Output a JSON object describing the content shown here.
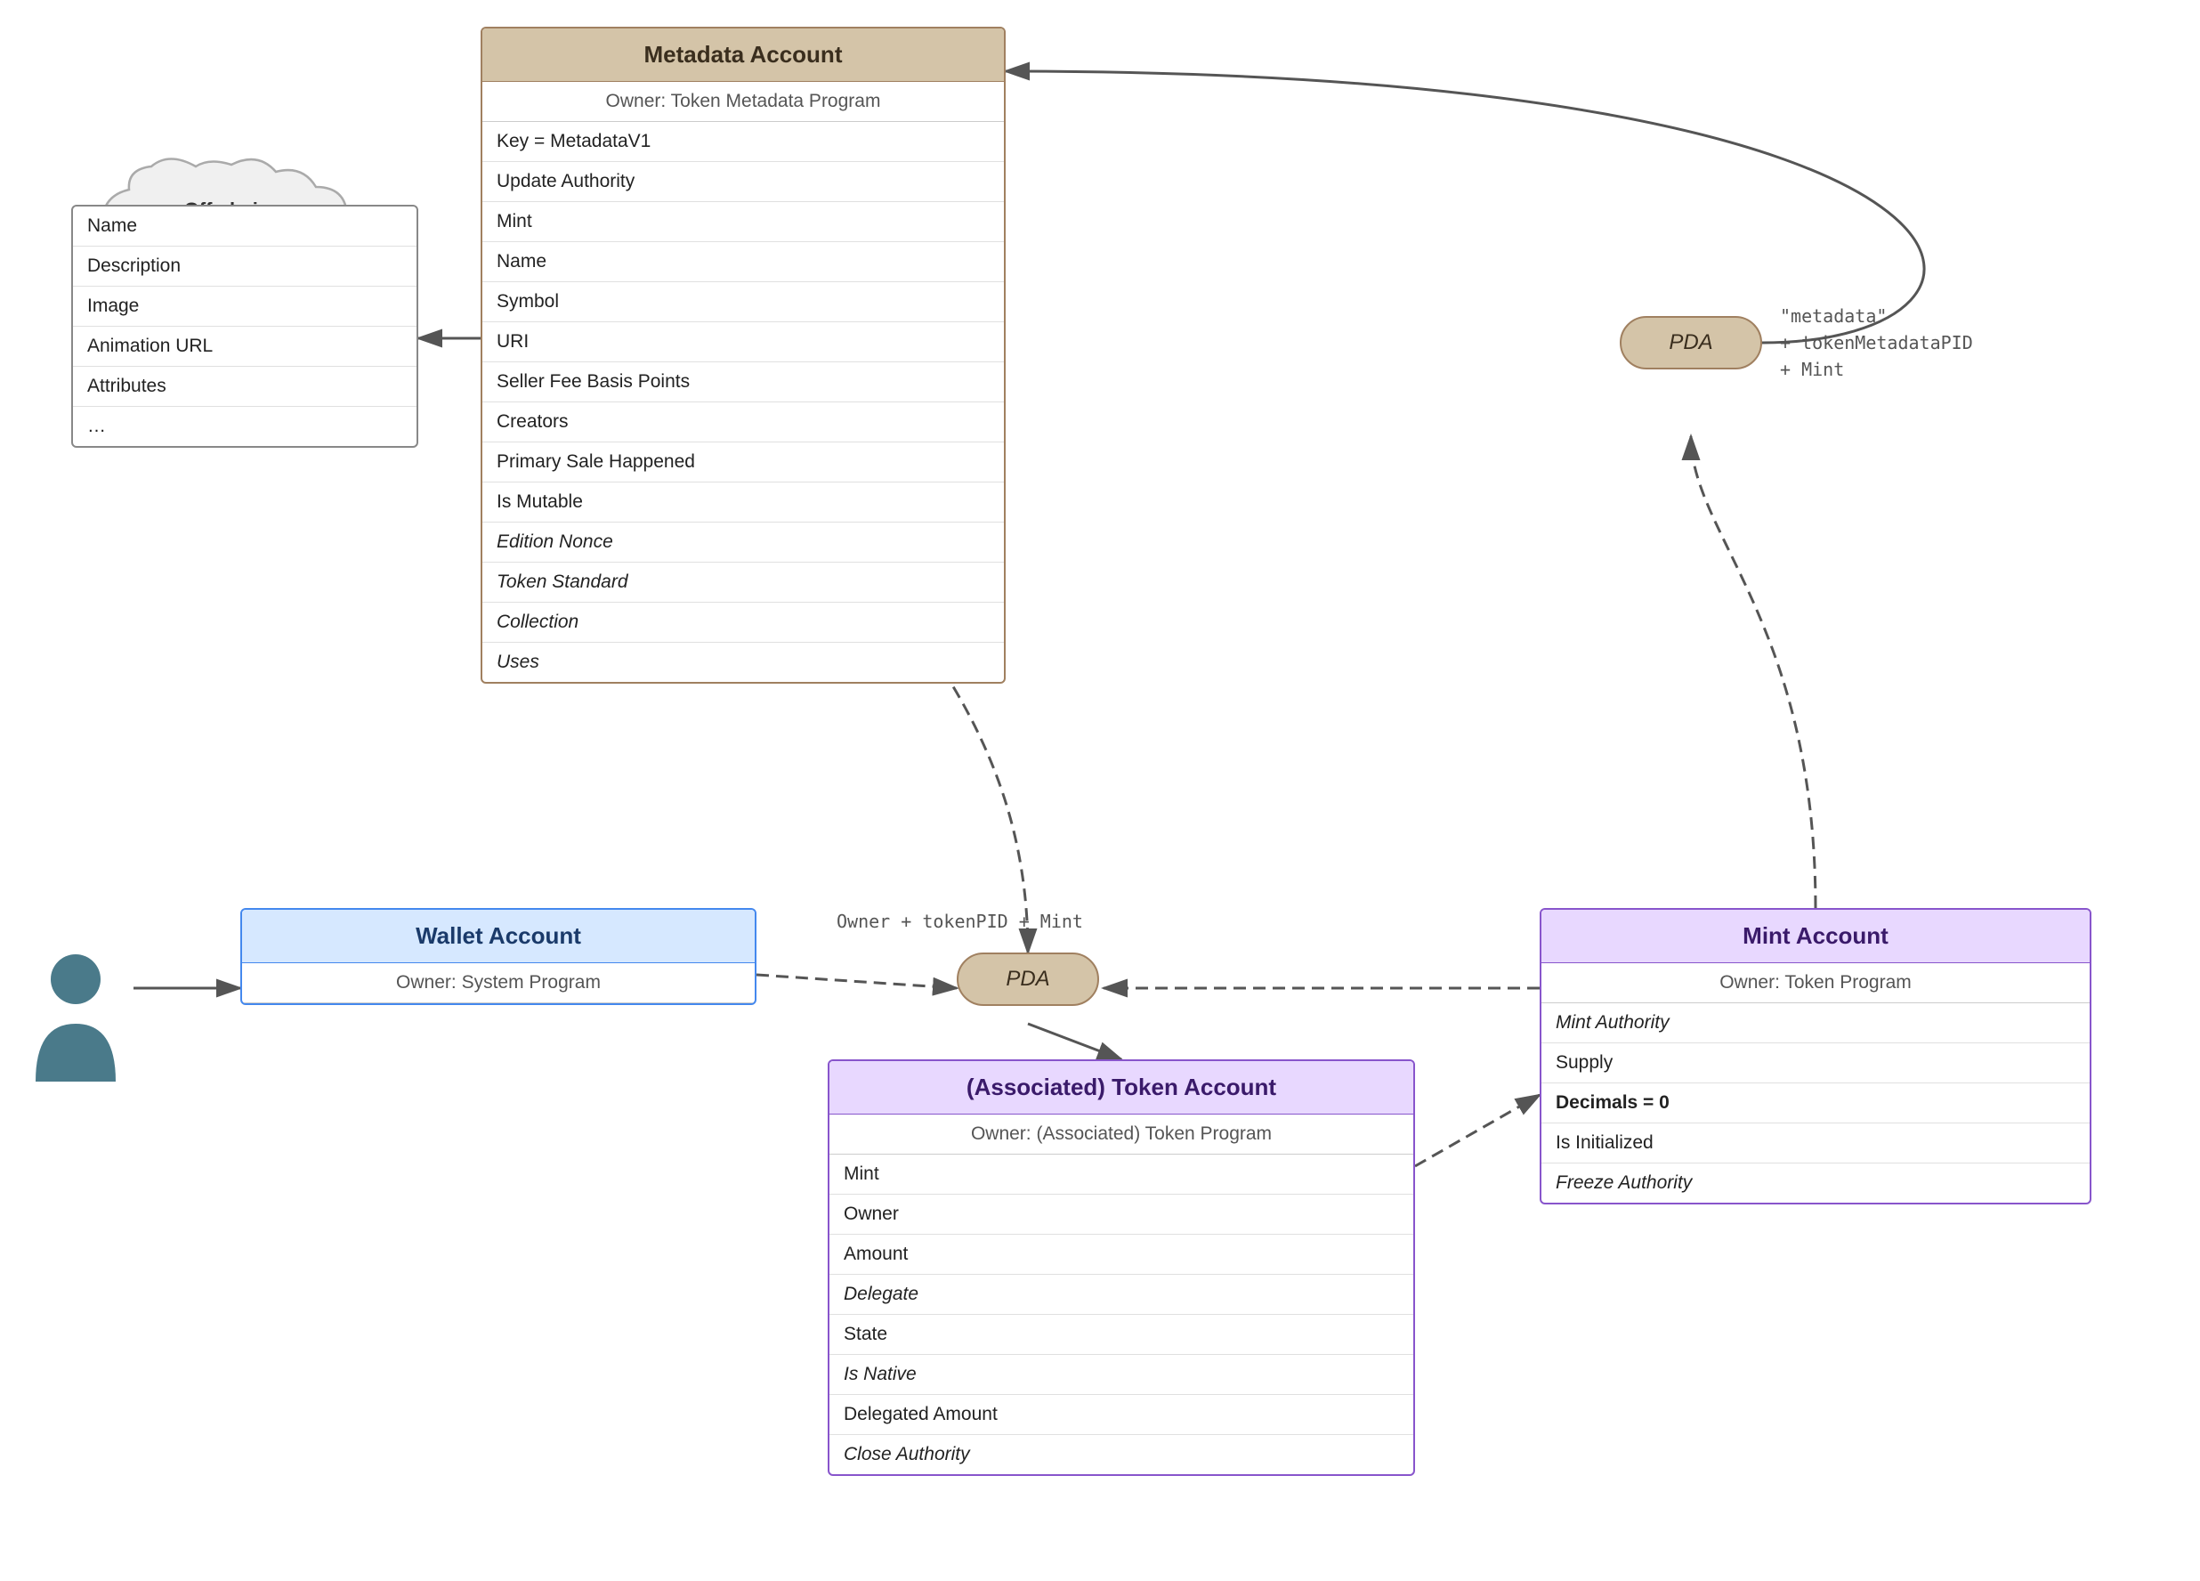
{
  "metadata_account": {
    "title": "Metadata Account",
    "owner": "Owner: Token Metadata Program",
    "rows": [
      {
        "text": "Key = MetadataV1",
        "style": "normal"
      },
      {
        "text": "Update Authority",
        "style": "normal"
      },
      {
        "text": "Mint",
        "style": "normal"
      },
      {
        "text": "Name",
        "style": "normal"
      },
      {
        "text": "Symbol",
        "style": "normal"
      },
      {
        "text": "URI",
        "style": "normal"
      },
      {
        "text": "Seller Fee Basis Points",
        "style": "normal"
      },
      {
        "text": "Creators",
        "style": "normal"
      },
      {
        "text": "Primary Sale Happened",
        "style": "normal"
      },
      {
        "text": "Is Mutable",
        "style": "normal"
      },
      {
        "text": "Edition Nonce",
        "style": "italic"
      },
      {
        "text": "Token Standard",
        "style": "italic"
      },
      {
        "text": "Collection",
        "style": "italic"
      },
      {
        "text": "Uses",
        "style": "italic"
      }
    ]
  },
  "offchain_json": {
    "title": "Off-chain\nJSON Object",
    "rows": [
      {
        "text": "Name",
        "style": "normal"
      },
      {
        "text": "Description",
        "style": "normal"
      },
      {
        "text": "Image",
        "style": "normal"
      },
      {
        "text": "Animation URL",
        "style": "normal"
      },
      {
        "text": "Attributes",
        "style": "normal"
      },
      {
        "text": "…",
        "style": "normal"
      }
    ]
  },
  "wallet_account": {
    "title": "Wallet Account",
    "owner": "Owner: System Program"
  },
  "mint_account": {
    "title": "Mint Account",
    "owner": "Owner: Token Program",
    "rows": [
      {
        "text": "Mint Authority",
        "style": "italic"
      },
      {
        "text": "Supply",
        "style": "normal"
      },
      {
        "text": "Decimals = 0",
        "style": "bold"
      },
      {
        "text": "Is Initialized",
        "style": "normal"
      },
      {
        "text": "Freeze Authority",
        "style": "italic"
      }
    ]
  },
  "token_account": {
    "title": "(Associated) Token Account",
    "owner": "Owner: (Associated) Token Program",
    "rows": [
      {
        "text": "Mint",
        "style": "normal"
      },
      {
        "text": "Owner",
        "style": "normal"
      },
      {
        "text": "Amount",
        "style": "normal"
      },
      {
        "text": "Delegate",
        "style": "italic"
      },
      {
        "text": "State",
        "style": "normal"
      },
      {
        "text": "Is Native",
        "style": "italic"
      },
      {
        "text": "Delegated Amount",
        "style": "normal"
      },
      {
        "text": "Close Authority",
        "style": "italic"
      }
    ]
  },
  "pda_top": {
    "label": "PDA"
  },
  "pda_bottom": {
    "label": "PDA"
  },
  "pda_top_annotation": "\"metadata\"\n+ tokenMetadataPID\n+ Mint",
  "pda_bottom_annotation": "Owner + tokenPID + Mint"
}
